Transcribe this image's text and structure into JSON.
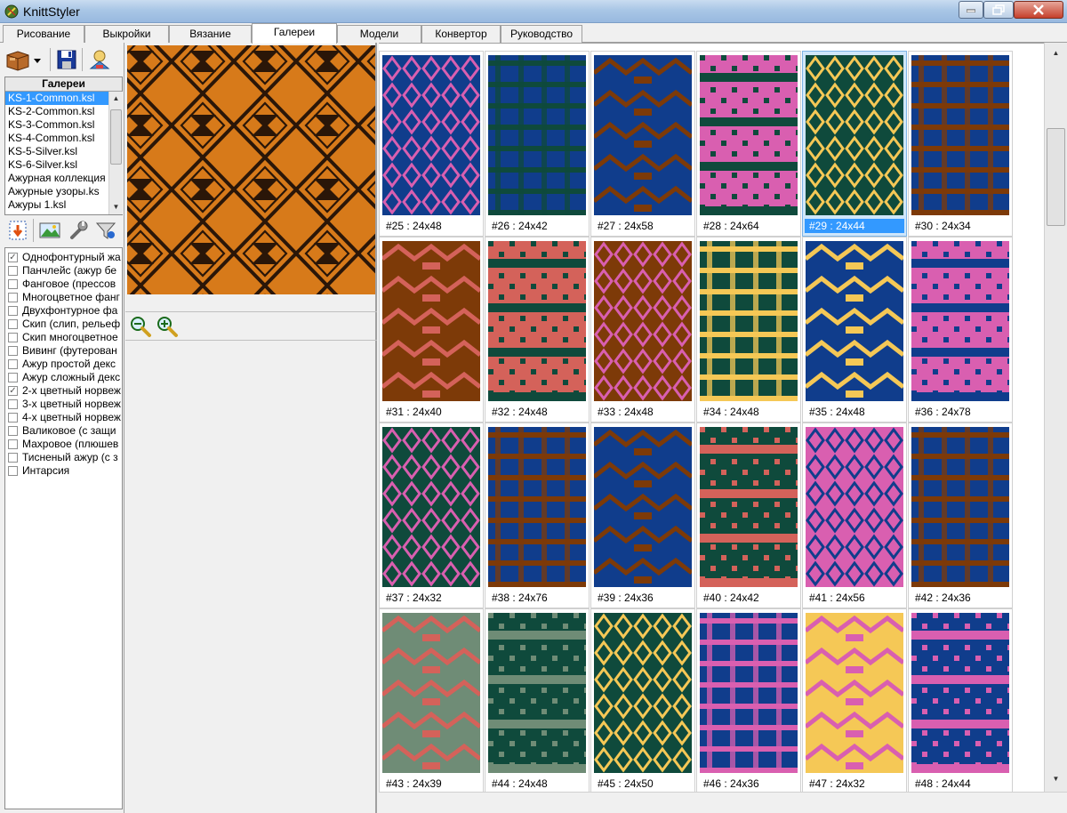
{
  "window": {
    "title": "KnittStyler"
  },
  "tabs": [
    {
      "label": "Рисование"
    },
    {
      "label": "Выкройки"
    },
    {
      "label": "Вязание"
    },
    {
      "label": "Галереи",
      "active": true
    },
    {
      "label": "Модели"
    },
    {
      "label": "Конвертор"
    },
    {
      "label": "Руководство"
    }
  ],
  "toolbar": {
    "icons": [
      "open-menu-icon",
      "dropdown-arrow-icon",
      "save-icon",
      "print-preview-icon"
    ]
  },
  "galleries": {
    "header": "Галереи",
    "items": [
      {
        "label": "KS-1-Common.ksl",
        "selected": true
      },
      {
        "label": "KS-2-Common.ksl"
      },
      {
        "label": "KS-3-Common.ksl"
      },
      {
        "label": "KS-4-Common.ksl"
      },
      {
        "label": "KS-5-Silver.ksl"
      },
      {
        "label": "KS-6-Silver.ksl"
      },
      {
        "label": "Ажурная коллекция"
      },
      {
        "label": "Ажурные узоры.ks"
      },
      {
        "label": "Ажуры 1.ksl"
      }
    ]
  },
  "gallery_tools": {
    "icons": [
      "import-icon",
      "image-icon",
      "wrench-icon",
      "filter-icon"
    ]
  },
  "technique_types": [
    {
      "label": "Однофонтурный жа",
      "checked": true
    },
    {
      "label": "Панчлейс (ажур бе",
      "checked": false
    },
    {
      "label": "Фанговое (прессов",
      "checked": false
    },
    {
      "label": "Многоцветное фанг",
      "checked": false
    },
    {
      "label": "Двухфонтурное фа",
      "checked": false
    },
    {
      "label": "Скип (слип, рельеф",
      "checked": false
    },
    {
      "label": "Скип многоцветное",
      "checked": false
    },
    {
      "label": "Вивинг (футерован",
      "checked": false
    },
    {
      "label": "Ажур простой декс",
      "checked": false
    },
    {
      "label": "Ажур сложный декс",
      "checked": false
    },
    {
      "label": "2-х цветный норвеж",
      "checked": true
    },
    {
      "label": "3-х цветный норвеж",
      "checked": false
    },
    {
      "label": "4-х цветный норвеж",
      "checked": false
    },
    {
      "label": "Валиковое (с защи",
      "checked": false
    },
    {
      "label": "Махровое (плюшев",
      "checked": false
    },
    {
      "label": "Тисненый ажур (с з",
      "checked": false
    },
    {
      "label": "Интарсия",
      "checked": false
    }
  ],
  "zoom": {
    "icons": [
      "zoom-out-icon",
      "zoom-in-icon"
    ]
  },
  "colors": {
    "green": "#0f4a3c",
    "blue": "#103d8c",
    "pink": "#d95fb0",
    "brown": "#7d3a08",
    "yellow": "#f5c856",
    "salmon": "#d4625a",
    "sage": "#6f8c76",
    "orange": "#d77a1a",
    "dark": "#2a1608"
  },
  "patterns": [
    {
      "label": "#25 : 24x48",
      "colors": [
        "#103d8c",
        "#d95fb0"
      ]
    },
    {
      "label": "#26 : 24x42",
      "colors": [
        "#103d8c",
        "#0f4a3c"
      ]
    },
    {
      "label": "#27 : 24x58",
      "colors": [
        "#103d8c",
        "#7d3a08"
      ]
    },
    {
      "label": "#28 : 24x64",
      "colors": [
        "#d95fb0",
        "#0f4a3c"
      ]
    },
    {
      "label": "#29 : 24x44",
      "colors": [
        "#0f4a3c",
        "#f5c856"
      ],
      "selected": true
    },
    {
      "label": "#30 : 24x34",
      "colors": [
        "#103d8c",
        "#7d3a08"
      ]
    },
    {
      "label": "#31 : 24x40",
      "colors": [
        "#7d3a08",
        "#d4625a"
      ]
    },
    {
      "label": "#32 : 24x48",
      "colors": [
        "#d4625a",
        "#0f4a3c"
      ]
    },
    {
      "label": "#33 : 24x48",
      "colors": [
        "#7d3a08",
        "#d95fb0"
      ]
    },
    {
      "label": "#34 : 24x48",
      "colors": [
        "#0f4a3c",
        "#f5c856"
      ]
    },
    {
      "label": "#35 : 24x48",
      "colors": [
        "#103d8c",
        "#f5c856"
      ]
    },
    {
      "label": "#36 : 24x78",
      "colors": [
        "#d95fb0",
        "#103d8c"
      ]
    },
    {
      "label": "#37 : 24x32",
      "colors": [
        "#0f4a3c",
        "#d95fb0"
      ]
    },
    {
      "label": "#38 : 24x76",
      "colors": [
        "#103d8c",
        "#7d3a08"
      ]
    },
    {
      "label": "#39 : 24x36",
      "colors": [
        "#103d8c",
        "#7d3a08"
      ]
    },
    {
      "label": "#40 : 24x42",
      "colors": [
        "#0f4a3c",
        "#d4625a"
      ]
    },
    {
      "label": "#41 : 24x56",
      "colors": [
        "#d95fb0",
        "#103d8c"
      ]
    },
    {
      "label": "#42 : 24x36",
      "colors": [
        "#103d8c",
        "#7d3a08"
      ]
    },
    {
      "label": "#43 : 24x39",
      "colors": [
        "#6f8c76",
        "#d4625a"
      ]
    },
    {
      "label": "#44 : 24x48",
      "colors": [
        "#0f4a3c",
        "#6f8c76"
      ]
    },
    {
      "label": "#45 : 24x50",
      "colors": [
        "#0f4a3c",
        "#f5c856"
      ]
    },
    {
      "label": "#46 : 24x36",
      "colors": [
        "#103d8c",
        "#d95fb0"
      ]
    },
    {
      "label": "#47 : 24x32",
      "colors": [
        "#f5c856",
        "#d95fb0"
      ]
    },
    {
      "label": "#48 : 24x44",
      "colors": [
        "#103d8c",
        "#d95fb0"
      ]
    }
  ]
}
